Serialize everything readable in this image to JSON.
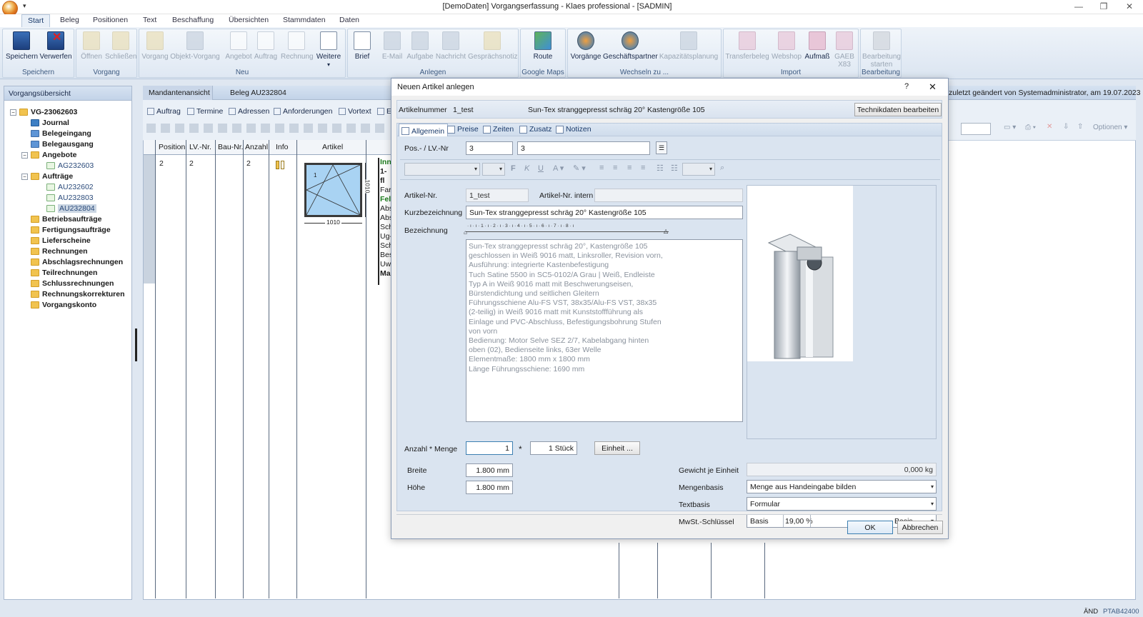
{
  "window": {
    "title": "[DemoDaten] Vorgangserfassung - Klaes professional - [SADMIN]"
  },
  "ribbon_tabs": [
    "Start",
    "Beleg",
    "Positionen",
    "Text",
    "Beschaffung",
    "Übersichten",
    "Stammdaten",
    "Daten"
  ],
  "ribbon": {
    "groups": {
      "speichern": "Speichern",
      "vorgang": "Vorgang",
      "neu": "Neu",
      "anlegen": "Anlegen",
      "google_maps": "Google Maps",
      "wechseln": "Wechseln zu ...",
      "import": "Import",
      "bearbeitung": "Bearbeitung"
    },
    "buttons": {
      "speichern": "Speichern",
      "verwerfen": "Verwerfen",
      "oeffnen": "Öffnen",
      "schliessen": "Schließen",
      "vorgang": "Vorgang",
      "objekt_vorgang": "Objekt-Vorgang",
      "angebot": "Angebot",
      "auftrag": "Auftrag",
      "rechnung": "Rechnung",
      "weitere": "Weitere",
      "brief": "Brief",
      "email": "E-Mail",
      "aufgabe": "Aufgabe",
      "nachricht": "Nachricht",
      "gespraechsnotiz": "Gesprächsnotiz",
      "route": "Route",
      "vorgaenge": "Vorgänge",
      "geschaeftspartner": "Geschäftspartner",
      "kapazitaetsplanung": "Kapazitätsplanung",
      "transferbeleg": "Transferbeleg",
      "webshop": "Webshop",
      "aufmass": "Aufmaß",
      "gaeb_x83_1": "GAEB",
      "gaeb_x83_2": "X83",
      "bearbeitung_starten_1": "Bearbeitung",
      "bearbeitung_starten_2": "starten"
    }
  },
  "left_panel": {
    "title": "Vorgangsübersicht",
    "root": "VG-23062603",
    "items": {
      "journal": "Journal",
      "belegeingang": "Belegeingang",
      "belegausgang": "Belegausgang",
      "angebote": "Angebote",
      "ag232603": "AG232603",
      "auftraege": "Aufträge",
      "au232602": "AU232602",
      "au232803": "AU232803",
      "au232804": "AU232804",
      "betriebsauftraege": "Betriebsaufträge",
      "fertigungsauftraege": "Fertigungsaufträge",
      "lieferscheine": "Lieferscheine",
      "rechnungen": "Rechnungen",
      "abschlagsrechnungen": "Abschlagsrechnungen",
      "teilrechnungen": "Teilrechnungen",
      "schlussrechnungen": "Schlussrechnungen",
      "rechnungskorrekturen": "Rechnungskorrekturen",
      "vorgangskonto": "Vorgangskonto"
    }
  },
  "main": {
    "tabs": {
      "mandantenansicht": "Mandantenansicht",
      "beleg": "Beleg AU232804"
    },
    "last_changed": "zuletzt geändert von Systemadministrator, am 19.07.2023",
    "toolbar": {
      "auftrag": "Auftrag",
      "termine": "Termine",
      "adressen": "Adressen",
      "anforderungen": "Anforderungen",
      "vortext": "Vortext",
      "more": "Ei"
    },
    "options_label": "Optionen",
    "columns": {
      "position": "Position",
      "lv_nr": "LV.-Nr.",
      "bau_nr": "Bau-Nr.",
      "anzahl": "Anzahl",
      "info": "Info",
      "artikel": "Artikel"
    },
    "row": {
      "position": "2",
      "lv_nr": "2",
      "anzahl": "2",
      "dim_w": "1010",
      "dim_h": "1010",
      "sash": "1",
      "text_lines": [
        "Inn",
        "1-fl",
        "Far",
        "Fel",
        "Abs",
        "Abs",
        "Sch",
        "Ug-",
        "Sch",
        "Bes",
        "Uw-",
        "Ma"
      ]
    }
  },
  "dialog": {
    "title": "Neuen Artikel anlegen",
    "help": "?",
    "info": {
      "artikelnummer_label": "Artikelnummer",
      "artikelnummer": "1_test",
      "name": "Sun-Tex stranggepresst schräg 20° Kastengröße 105",
      "technik_button": "Technikdaten bearbeiten"
    },
    "tabs": {
      "allgemein": "Allgemein",
      "preise": "Preise",
      "zeiten": "Zeiten",
      "zusatz": "Zusatz",
      "notizen": "Notizen"
    },
    "pos_label": "Pos.- / LV.-Nr",
    "pos": "3",
    "lv": "3",
    "artikel_nr_label": "Artikel-Nr.",
    "artikel_nr": "1_test",
    "artikel_nr_intern_label": "Artikel-Nr.  intern",
    "artikel_nr_intern": "",
    "kurzbezeichnung_label": "Kurzbezeichnung",
    "kurzbezeichnung": "Sun-Tex stranggepresst schräg 20° Kastengröße 105",
    "bezeichnung_label": "Bezeichnung",
    "ruler": "· ı · ı · 1 · ı · 2 · ı · 3 · ı · 4 · ı · 5 · ı · 6 · ı · 7 · ı · 8 · ı",
    "bezeichnung_lines": [
      "Sun-Tex stranggepresst schräg 20°, Kastengröße 105",
      "geschlossen in Weiß 9016 matt, Linksroller, Revision vorn,",
      "Ausführung: integrierte Kastenbefestigung",
      "Tuch Satine 5500 in SC5-0102/A Grau | Weiß, Endleiste",
      "Typ A in Weiß 9016 matt mit Beschwerungseisen,",
      "Bürstendichtung und seitlichen Gleitern",
      "Führungsschiene Alu-FS VST, 38x35/Alu-FS VST, 38x35",
      "(2-teilig) in Weiß 9016 matt mit Kunststoffführung als",
      "Einlage und PVC-Abschluss, Befestigungsbohrung Stufen",
      "von vorn",
      "Bedienung: Motor Selve SEZ 2/7, Kabelabgang hinten",
      "oben (02), Bedienseite links, 63er Welle",
      "Elementmaße: 1800 mm x 1800 mm",
      "Länge Führungsschiene: 1690 mm"
    ],
    "anzahl_label": "Anzahl * Menge",
    "anzahl": "1",
    "times": "*",
    "menge": "1 Stück",
    "einheit_button": "Einheit ...",
    "breite_label": "Breite",
    "breite": "1.800 mm",
    "hoehe_label": "Höhe",
    "hoehe": "1.800 mm",
    "gewicht_label": "Gewicht je Einheit",
    "gewicht": "0,000 kg",
    "mengenbasis_label": "Mengenbasis",
    "mengenbasis": "Menge aus Handeingabe bilden",
    "textbasis_label": "Textbasis",
    "textbasis": "Formular",
    "mwst_label": "MwSt.-Schlüssel",
    "mwst_basis": "Basis",
    "mwst_rate": "19,00 %",
    "mwst_right": "Basis",
    "ok": "OK",
    "cancel": "Abbrechen"
  },
  "status": {
    "mode": "ÄND",
    "code": "PTAB42400"
  }
}
